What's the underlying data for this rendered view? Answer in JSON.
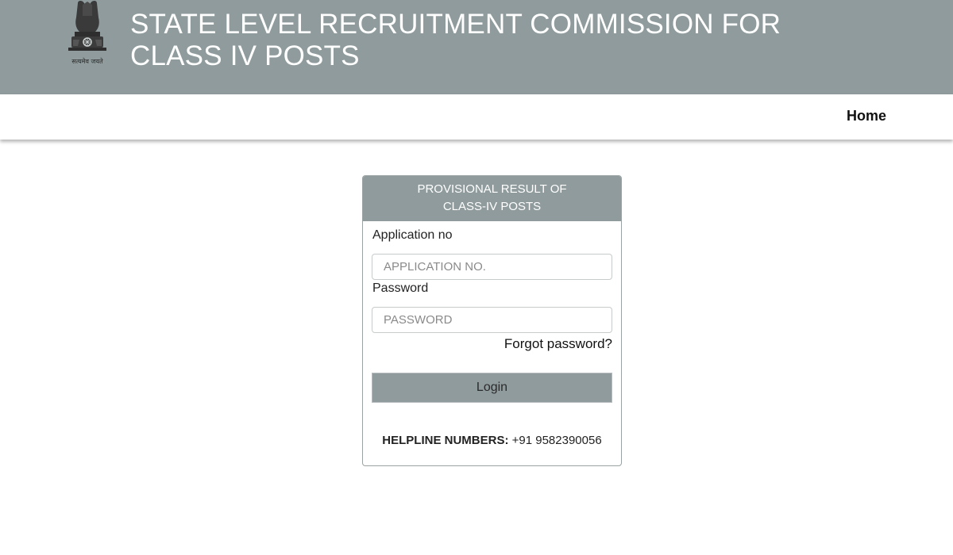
{
  "header": {
    "emblem_motto": "सत्यमेव जयते",
    "title": "STATE LEVEL RECRUITMENT COMMISSION FOR CLASS IV POSTS"
  },
  "nav": {
    "home_label": "Home"
  },
  "login_card": {
    "title": "PROVISIONAL RESULT OF CLASS-IV POSTS",
    "application_label": "Application no",
    "application_placeholder": "APPLICATION NO.",
    "password_label": "Password",
    "password_placeholder": "PASSWORD",
    "forgot_password": "Forgot password?",
    "login_button": "Login",
    "helpline_label": "HELPLINE NUMBERS:",
    "helpline_number": "+91 9582390056"
  },
  "colors": {
    "header_bg": "#8f9b9c",
    "card_header_bg": "#8f9b9c",
    "button_bg": "#8f9b9c"
  }
}
